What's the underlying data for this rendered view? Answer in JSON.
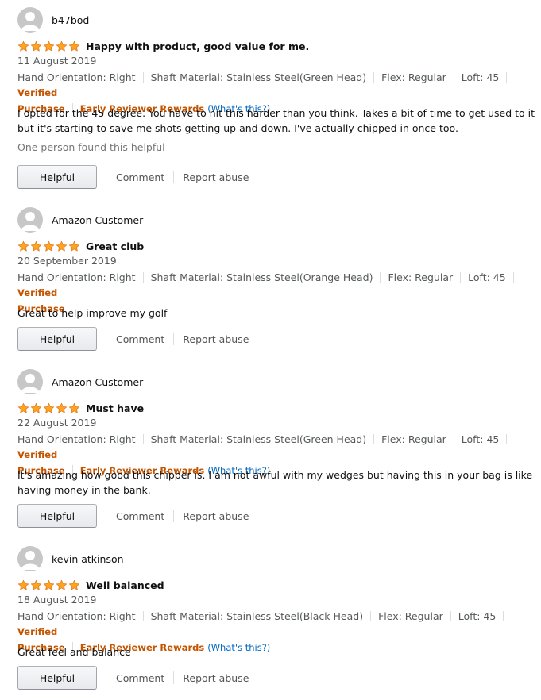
{
  "reviews": [
    {
      "profile_name": "b47bod",
      "stars": 5,
      "title": "Happy with product, good value for me.",
      "date": "11 August 2019",
      "attributes": [
        "Hand Orientation: Right",
        "Shaft Material: Stainless Steel(Green Head)",
        "Flex: Regular",
        "Loft: 45"
      ],
      "badge_line1": "Verified",
      "badge_line2": "Purchase",
      "reward_label": "Early Reviewer Rewards",
      "reward_link": "(What's this?)",
      "body": "I opted for the 45 degree. You have to hit this harder than you think. Takes a bit of time to get used to it but it's starting to save me shots getting up and down. I've actually chipped in once too.",
      "helpful_text": "One person found this helpful",
      "helpful_button": "Helpful",
      "comment_label": "Comment",
      "report_label": "Report abuse"
    },
    {
      "profile_name": "Amazon Customer",
      "stars": 5,
      "title": "Great club",
      "date": "20 September 2019",
      "attributes": [
        "Hand Orientation: Right",
        "Shaft Material: Stainless Steel(Orange Head)",
        "Flex: Regular",
        "Loft: 45"
      ],
      "badge_line1": "Verified",
      "badge_line2": "Purchase",
      "body": "Great to help improve my golf",
      "helpful_button": "Helpful",
      "comment_label": "Comment",
      "report_label": "Report abuse"
    },
    {
      "profile_name": "Amazon Customer",
      "stars": 5,
      "title": "Must have",
      "date": "22 August 2019",
      "attributes": [
        "Hand Orientation: Right",
        "Shaft Material: Stainless Steel(Green Head)",
        "Flex: Regular",
        "Loft: 45"
      ],
      "badge_line1": "Verified",
      "badge_line2": "Purchase",
      "reward_label": "Early Reviewer Rewards",
      "reward_link": "(What's this?)",
      "body": "It's amazing how good this chipper is. I am not awful with my wedges but having this in your bag is like having money in the bank.",
      "helpful_button": "Helpful",
      "comment_label": "Comment",
      "report_label": "Report abuse"
    },
    {
      "profile_name": "kevin atkinson",
      "stars": 5,
      "title": "Well balanced",
      "date": "18 August 2019",
      "attributes": [
        "Hand Orientation: Right",
        "Shaft Material: Stainless Steel(Black Head)",
        "Flex: Regular",
        "Loft: 45"
      ],
      "badge_line1": "Verified",
      "badge_line2": "Purchase",
      "reward_label": "Early Reviewer Rewards",
      "reward_link": "(What's this?)",
      "body": "Great feel and balance",
      "helpful_button": "Helpful",
      "comment_label": "Comment",
      "report_label": "Report abuse"
    }
  ],
  "colors": {
    "star_fill": "#ffa41c",
    "star_stroke": "#de7921",
    "badge": "#c45500",
    "link": "#0066c0"
  },
  "icons": {
    "avatar": "default-avatar-icon",
    "star": "star-filled-icon"
  }
}
